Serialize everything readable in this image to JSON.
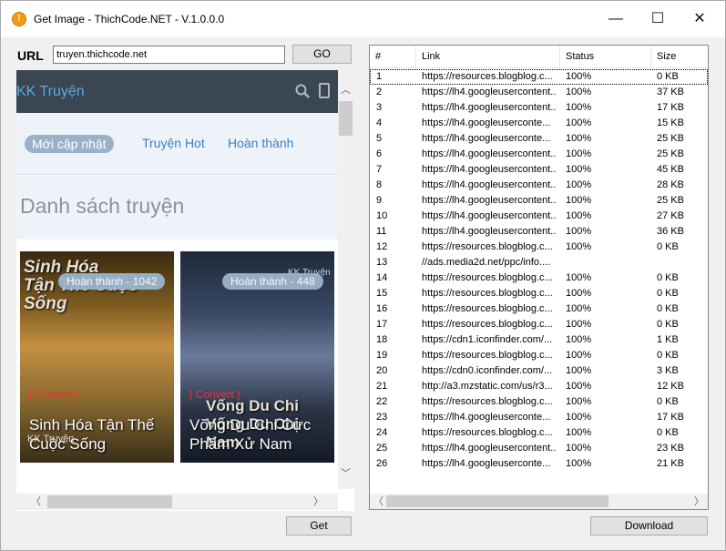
{
  "window": {
    "title": "Get Image - ThichCode.NET - V.1.0.0.0",
    "app_icon_glyph": "!",
    "minimize_glyph": "—",
    "maximize_glyph": "☐",
    "close_glyph": "✕"
  },
  "url_bar": {
    "label": "URL",
    "value": "truyen.thichcode.net",
    "go_label": "GO"
  },
  "browser": {
    "site_logo": "KK Truyện",
    "nav_tabs": [
      "Mới cập nhật",
      "Truyện Hot",
      "Hoàn thành"
    ],
    "section_title": "Danh sách truyện",
    "cards": [
      {
        "art_title": "Sinh Hóa\nTận Thế Cuộc Sống",
        "badge": "Hoàn thành - 1042",
        "convert_tag": "[ Convert ]",
        "name": "Sinh Hóa Tận Thế Cuộc Sống",
        "ghost_text": "KK Truyện"
      },
      {
        "art_title": "Vống Du Chi\nVống Du Chi Nam",
        "badge": "Hoàn thành - 448",
        "brand": "KK Truyện",
        "convert_tag": "[ Convert ]",
        "name": "Võng Du Chi Cực Phẩm Xử Nam"
      }
    ]
  },
  "buttons": {
    "get_label": "Get",
    "download_label": "Download"
  },
  "list": {
    "columns": [
      "#",
      "Link",
      "Status",
      "Size"
    ],
    "rows": [
      {
        "num": "1",
        "link": "https://resources.blogblog.c...",
        "status": "100%",
        "size": "0 KB"
      },
      {
        "num": "2",
        "link": "https://lh4.googleusercontent...",
        "status": "100%",
        "size": "37 KB"
      },
      {
        "num": "3",
        "link": "https://lh4.googleusercontent...",
        "status": "100%",
        "size": "17 KB"
      },
      {
        "num": "4",
        "link": "https://lh4.googleuserconte...",
        "status": "100%",
        "size": "15 KB"
      },
      {
        "num": "5",
        "link": "https://lh4.googleuserconte...",
        "status": "100%",
        "size": "25 KB"
      },
      {
        "num": "6",
        "link": "https://lh4.googleusercontent...",
        "status": "100%",
        "size": "25 KB"
      },
      {
        "num": "7",
        "link": "https://lh4.googleusercontent...",
        "status": "100%",
        "size": "45 KB"
      },
      {
        "num": "8",
        "link": "https://lh4.googleusercontent...",
        "status": "100%",
        "size": "28 KB"
      },
      {
        "num": "9",
        "link": "https://lh4.googleusercontent...",
        "status": "100%",
        "size": "25 KB"
      },
      {
        "num": "10",
        "link": "https://lh4.googleusercontent...",
        "status": "100%",
        "size": "27 KB"
      },
      {
        "num": "11",
        "link": "https://lh4.googleusercontent...",
        "status": "100%",
        "size": "36 KB"
      },
      {
        "num": "12",
        "link": "https://resources.blogblog.c...",
        "status": "100%",
        "size": "0 KB"
      },
      {
        "num": "13",
        "link": "//ads.media2d.net/ppc/info....",
        "status": "",
        "size": ""
      },
      {
        "num": "14",
        "link": "https://resources.blogblog.c...",
        "status": "100%",
        "size": "0 KB"
      },
      {
        "num": "15",
        "link": "https://resources.blogblog.c...",
        "status": "100%",
        "size": "0 KB"
      },
      {
        "num": "16",
        "link": "https://resources.blogblog.c...",
        "status": "100%",
        "size": "0 KB"
      },
      {
        "num": "17",
        "link": "https://resources.blogblog.c...",
        "status": "100%",
        "size": "0 KB"
      },
      {
        "num": "18",
        "link": "https://cdn1.iconfinder.com/...",
        "status": "100%",
        "size": "1 KB"
      },
      {
        "num": "19",
        "link": "https://resources.blogblog.c...",
        "status": "100%",
        "size": "0 KB"
      },
      {
        "num": "20",
        "link": "https://cdn0.iconfinder.com/...",
        "status": "100%",
        "size": "3 KB"
      },
      {
        "num": "21",
        "link": "http://a3.mzstatic.com/us/r3...",
        "status": "100%",
        "size": "12 KB"
      },
      {
        "num": "22",
        "link": "https://resources.blogblog.c...",
        "status": "100%",
        "size": "0 KB"
      },
      {
        "num": "23",
        "link": "https://lh4.googleuserconte...",
        "status": "100%",
        "size": "17 KB"
      },
      {
        "num": "24",
        "link": "https://resources.blogblog.c...",
        "status": "100%",
        "size": "0 KB"
      },
      {
        "num": "25",
        "link": "https://lh4.googleusercontent...",
        "status": "100%",
        "size": "23 KB"
      },
      {
        "num": "26",
        "link": "https://lh4.googleuserconte...",
        "status": "100%",
        "size": "21 KB"
      }
    ]
  },
  "colors": {
    "site_header_bg": "#3b4653",
    "site_accent": "#5aa9e0",
    "active_tab_bg": "#9ab1c9",
    "convert_red": "#e33333"
  }
}
